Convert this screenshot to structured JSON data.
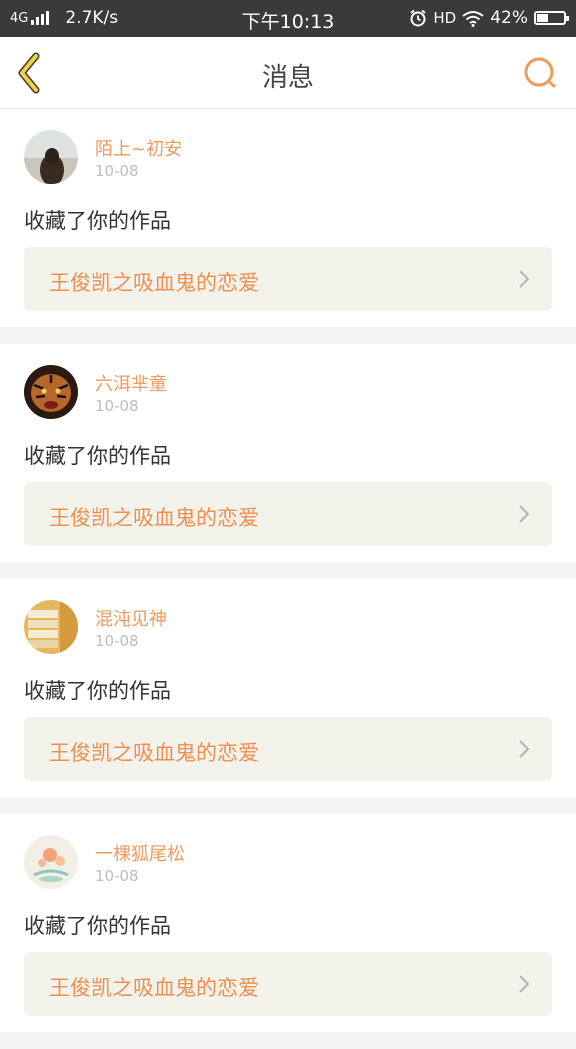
{
  "status_bar": {
    "network": "4G",
    "speed": "2.7K/s",
    "time": "下午10:13",
    "hd": "HD",
    "battery": "42%",
    "battery_level": 0.42,
    "signal_bars": 4
  },
  "header": {
    "title": "消息",
    "back_icon": "chevron-left-icon",
    "search_icon": "search-icon"
  },
  "colors": {
    "accent": "#ef9a5e",
    "back_arrow": "#f3d13a",
    "link_bg": "#f3f3ec"
  },
  "messages": [
    {
      "user": "陌上~初安",
      "date": "10-08",
      "action": "收藏了你的作品",
      "work": "王俊凯之吸血鬼的恋爱",
      "avatar": "avatar-girl-photo"
    },
    {
      "user": "六洱芈童",
      "date": "10-08",
      "action": "收藏了你的作品",
      "work": "王俊凯之吸血鬼的恋爱",
      "avatar": "avatar-tiger-photo"
    },
    {
      "user": "混沌见神",
      "date": "10-08",
      "action": "收藏了你的作品",
      "work": "王俊凯之吸血鬼的恋爱",
      "avatar": "avatar-books-photo"
    },
    {
      "user": "一棵狐尾松",
      "date": "10-08",
      "action": "收藏了你的作品",
      "work": "王俊凯之吸血鬼的恋爱",
      "avatar": "avatar-flower-drawing"
    }
  ]
}
